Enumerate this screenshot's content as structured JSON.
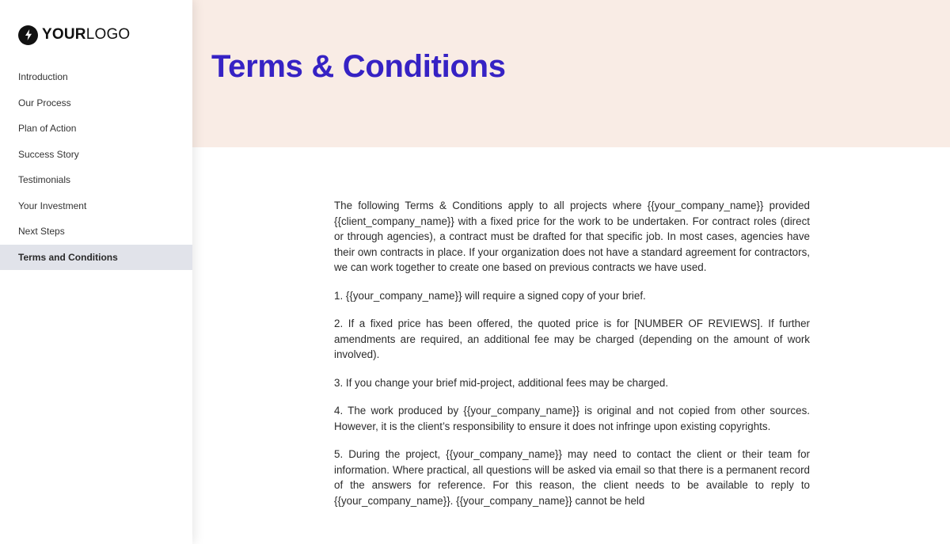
{
  "sidebar": {
    "logo": {
      "icon": "lightning-bolt-icon",
      "text_bold": "YOUR",
      "text_light": "LOGO"
    },
    "items": [
      {
        "label": "Introduction",
        "active": false
      },
      {
        "label": "Our Process",
        "active": false
      },
      {
        "label": "Plan of Action",
        "active": false
      },
      {
        "label": "Success Story",
        "active": false
      },
      {
        "label": "Testimonials",
        "active": false
      },
      {
        "label": "Your Investment",
        "active": false
      },
      {
        "label": "Next Steps",
        "active": false
      },
      {
        "label": "Terms and Conditions",
        "active": true
      }
    ]
  },
  "header": {
    "title": "Terms & Conditions"
  },
  "colors": {
    "title": "#3622c4",
    "hero_background": "#f9ece5",
    "active_nav_background": "#e1e3ea"
  },
  "content": {
    "paragraphs": [
      "The following Terms & Conditions apply to all projects where {{your_company_name}} provided {{client_company_name}}  with a fixed price for the work to be undertaken. For contract roles (direct or through agencies), a contract must be drafted for that specific job. In most cases, agencies have their own contracts in place. If your organization does not have a standard agreement for contractors, we can work together to create one based on previous contracts we have used.",
      "1. {{your_company_name}} will require a signed copy of your brief.",
      "2. If a fixed price has been offered, the quoted price is for [NUMBER OF REVIEWS]. If further amendments are required, an additional fee may be charged (depending on the amount of work involved).",
      "3. If you change your brief mid-project, additional fees may be charged.",
      "4. The work produced by {{your_company_name}} is original and not copied from other sources. However, it is the client’s responsibility to ensure it does not infringe upon existing copyrights.",
      "5. During the project, {{your_company_name}} may need to contact the client or their team for information. Where practical, all questions will be asked via email so that there is a permanent record of the answers for reference. For this reason, the client needs to be available to reply to {{your_company_name}}. {{your_company_name}} cannot be held"
    ]
  }
}
